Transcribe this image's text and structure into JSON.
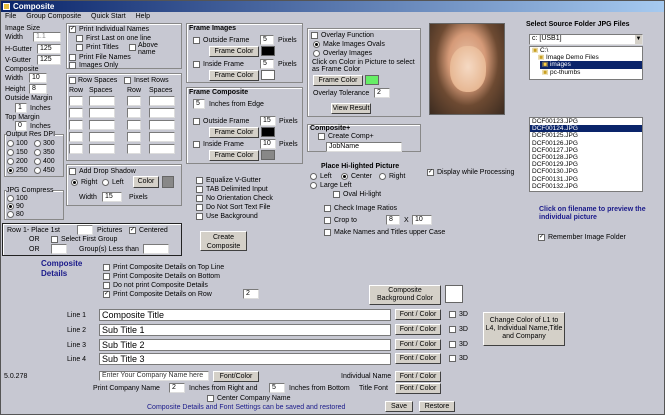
{
  "window": {
    "title": "Composite"
  },
  "menu": [
    "File",
    "Group Composite",
    "Quick Start",
    "Help"
  ],
  "left": {
    "image_size": "Image Size",
    "width_lbl": "Width",
    "width_val": "1.1",
    "hgutter_lbl": "H-Gutter",
    "hgutter_val": "125",
    "vgutter_lbl": "V-Gutter",
    "vgutter_val": "125",
    "composite_lbl": "Composite",
    "cwidth_lbl": "Width",
    "cwidth_val": "10",
    "height_lbl": "Height",
    "height_val": "8",
    "outside_margin": "Outside Margin",
    "om_val": "1",
    "inches": "Inches",
    "top_margin": "Top Margin",
    "tm_val": "0",
    "tm_unit": "Inches",
    "output_res": "Output Res  DPI",
    "dpi": [
      "100",
      "150",
      "200",
      "250",
      "300",
      "350",
      "400",
      "450"
    ],
    "jpg_compress": "JPG Compress",
    "jpg": [
      "100",
      "90",
      "80"
    ]
  },
  "names": {
    "print_individual": "Print Individual Names",
    "first_last": "First Last on one line",
    "print_titles": "Print Titles",
    "above_name": "Above name",
    "print_file_names": "Print File Names",
    "images_only": "Images Only"
  },
  "rows": {
    "row_spaces": "Row Spaces",
    "inset_rows": "Inset Rows",
    "row": "Row",
    "spaces": "Spaces"
  },
  "shadow": {
    "add": "Add Drop Shadow",
    "right": "Right",
    "left": "Left",
    "color": "Color",
    "width_lbl": "Width",
    "width_val": "15",
    "pixels": "Pixels"
  },
  "place": {
    "row1": "Row 1- Place 1st",
    "pictures": "Pictures",
    "centered": "Centered",
    "or1": "OR",
    "select_first": "Select First Group",
    "or2": "OR",
    "groups_less": "Group(s) Less than"
  },
  "frame_images": {
    "title": "Frame Images",
    "outside": "Outside Frame",
    "outside_val": "5",
    "pixels": "Pixels",
    "frame_color": "Frame Color",
    "inside": "Inside Frame",
    "inside_val": "5",
    "pixels2": "Pixels",
    "frame_color2": "Frame Color"
  },
  "frame_composite": {
    "title": "Frame Composite",
    "edge_val": "5",
    "edge_lbl": "Inches from Edge",
    "outside": "Outside Frame",
    "outside_val": "15",
    "pixels": "Pixels",
    "frame_color": "Frame Color",
    "inside": "Inside Frame",
    "inside_val": "10",
    "pixels2": "Pixels",
    "frame_color2": "Frame Color"
  },
  "options": {
    "equalize": "Equalize V-Gutter",
    "tab": "TAB Delimited Input",
    "no_orient": "No Orientation Check",
    "no_sort": "Do Not Sort Text File",
    "use_bg": "Use Background",
    "create": "Create Composite"
  },
  "overlay": {
    "function": "Overlay Function",
    "make_ovals": "Make Images Ovals",
    "overlay_images": "Overlay Images",
    "click_info": "Click on Color in Picture to select as Frame Color",
    "frame_color": "Frame Color",
    "tolerance": "Overlay Tolerance",
    "tolerance_val": "2",
    "view_result": "View Result"
  },
  "comp_plus": {
    "title": "Composite+",
    "create": "Create Comp+",
    "job": "JobName"
  },
  "hilight": {
    "title": "Place Hi-lighted Picture",
    "left": "Left",
    "center": "Center",
    "right": "Right",
    "large_left": "Large Left",
    "oval": "Oval Hi-light"
  },
  "ratios": {
    "check": "Check Image Ratios",
    "crop": "Crop to",
    "crop_w": "8",
    "x": "X",
    "crop_h": "10",
    "upper": "Make Names and Titles upper Case"
  },
  "display": "Display while Processing",
  "folder": {
    "title": "Select Source Folder JPG Files",
    "drive": "c: [USB1]",
    "tree": [
      "C:\\",
      "Image Demo Files",
      "images",
      "pc-thumbs"
    ],
    "files": [
      "DCF00123.JPG",
      "DCF00124.JPG",
      "DCF00125.JPG",
      "DCF00126.JPG",
      "DCF00127.JPG",
      "DCF00128.JPG",
      "DCF00129.JPG",
      "DCF00130.JPG",
      "DCF00131.JPG",
      "DCF00132.JPG"
    ],
    "hint": "Click on filename to preview the individual picture",
    "remember": "Remember Image Folder"
  },
  "details": {
    "title1": "Composite",
    "title2": "Details",
    "opts": [
      "Print Composite Details on Top Line",
      "Print Composite Details on Bottom",
      "Do not print Composite Details",
      "Print Composite Details on Row"
    ],
    "row_val": "2",
    "bg_color": "Composite Background Color",
    "lines": [
      {
        "label": "Line 1",
        "value": "Composite Title"
      },
      {
        "label": "Line 2",
        "value": "Sub Title 1"
      },
      {
        "label": "Line 3",
        "value": "Sub Title 2"
      },
      {
        "label": "Line 4",
        "value": "Sub Title 3"
      }
    ],
    "font_color": "Font / Color",
    "threed": "3D",
    "change_color": "Change Color of L1 to L4, Individual Name,Title and Company",
    "company_placeholder": "Enter Your Company Name here",
    "company_font": "Font/Color",
    "individual_name": "Individual Name",
    "title_font": "Title Font",
    "print_company": "Print Company Name",
    "cp_right_val": "2",
    "cp_right": "Inches from Right and",
    "cp_bottom_val": "5",
    "cp_bottom": "Inches from Bottom",
    "center_company": "Center Company Name",
    "footer": "Composite Details and  Font Settings can be saved and restored",
    "save": "Save",
    "restore": "Restore",
    "version": "5.0.278"
  },
  "colors": {
    "black": "#000000",
    "green": "#66ee66",
    "gray": "#888888",
    "white": "#ffffff"
  }
}
